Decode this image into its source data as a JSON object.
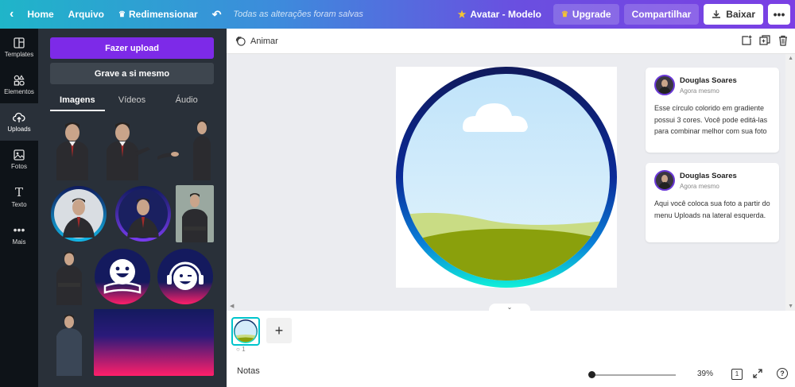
{
  "topbar": {
    "home": "Home",
    "file": "Arquivo",
    "resize": "Redimensionar",
    "saved_status": "Todas as alterações foram salvas",
    "design_name": "Avatar - Modelo",
    "upgrade": "Upgrade",
    "share": "Compartilhar",
    "download": "Baixar",
    "more": "•••"
  },
  "rail": {
    "items": [
      {
        "label": "Templates",
        "icon": "templates-icon"
      },
      {
        "label": "Elementos",
        "icon": "elements-icon"
      },
      {
        "label": "Uploads",
        "icon": "upload-cloud-icon"
      },
      {
        "label": "Fotos",
        "icon": "photo-icon"
      },
      {
        "label": "Texto",
        "icon": "text-icon"
      },
      {
        "label": "Mais",
        "icon": "more-icon"
      }
    ]
  },
  "panel": {
    "upload_button": "Fazer upload",
    "record_button": "Grave a si mesmo",
    "tabs": [
      "Imagens",
      "Vídeos",
      "Áudio"
    ]
  },
  "editor_toolbar": {
    "animate": "Animar"
  },
  "comments": [
    {
      "author": "Douglas Soares",
      "time": "Agora mesmo",
      "text": "Esse círculo colorido em gradiente possui 3 cores. Você pode editá-las para combinar melhor com sua foto"
    },
    {
      "author": "Douglas Soares",
      "time": "Agora mesmo",
      "text": "Aqui você coloca sua foto a partir do menu Uploads na lateral esquerda."
    }
  ],
  "pages_strip": {
    "page_comment_count": "1",
    "add_page": "+"
  },
  "footer": {
    "notes": "Notas",
    "zoom": "39%",
    "page_count": "1",
    "help": "?"
  },
  "colors": {
    "accent_purple": "#7d2ae8",
    "teal": "#00c4cc",
    "ring_top": "#101a5c",
    "ring_bottom": "#10e8d8"
  }
}
